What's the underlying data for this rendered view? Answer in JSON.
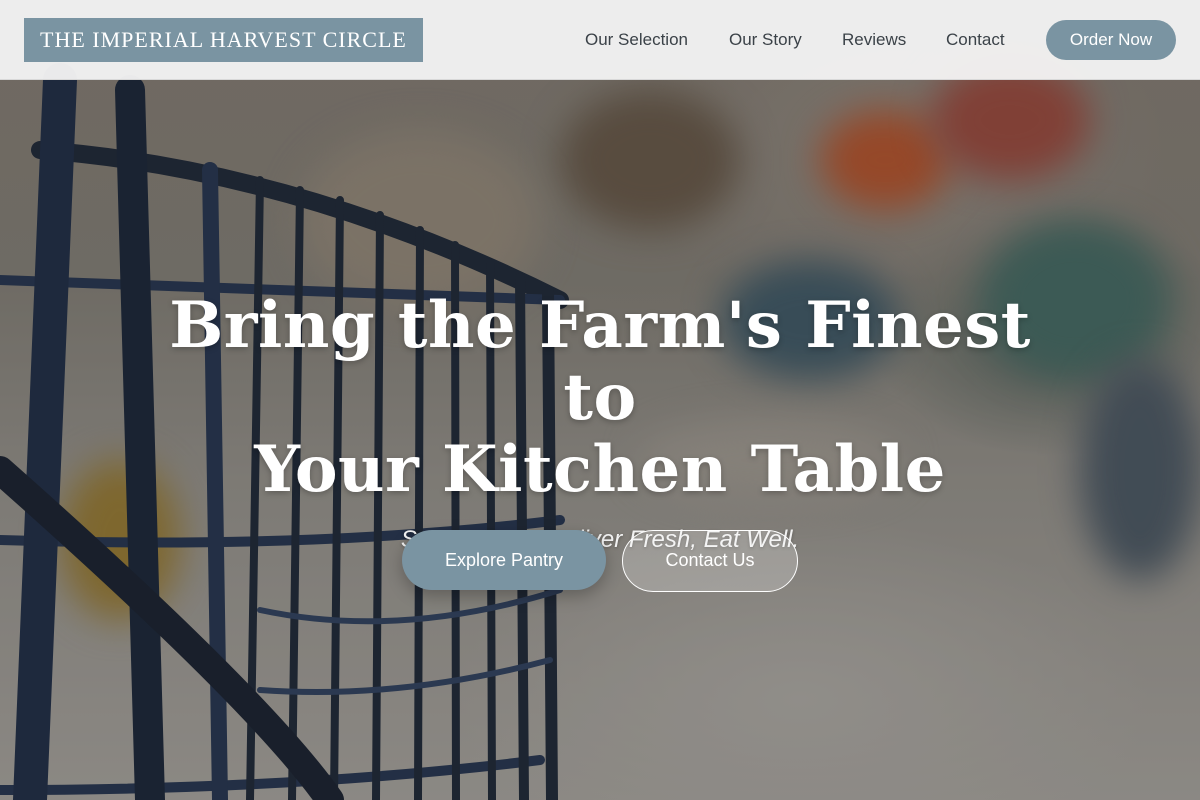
{
  "brand": {
    "name": "THE IMPERIAL HARVEST CIRCLE",
    "accent_color": "#7a94a2"
  },
  "nav": {
    "items": [
      {
        "label": "Our Selection"
      },
      {
        "label": "Our Story"
      },
      {
        "label": "Reviews"
      },
      {
        "label": "Contact"
      }
    ],
    "cta_label": "Order Now"
  },
  "hero": {
    "title_line1": "Bring the Farm's Finest to",
    "title_line2": "Your Kitchen Table",
    "tagline": "Source Pure, Deliver Fresh, Eat Well.",
    "primary_button": "Explore Pantry",
    "secondary_button": "Contact Us",
    "background_image": "blurred-grocery-store-with-shopping-cart"
  }
}
